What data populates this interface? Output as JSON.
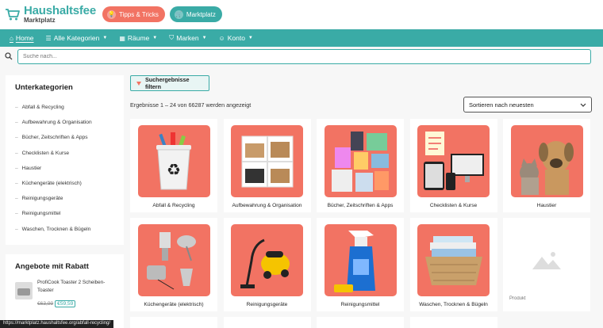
{
  "brand": {
    "name": "Haushaltsfee",
    "sub": "Marktplatz",
    "accent": "#3aaba6",
    "coral": "#f27363"
  },
  "topbar": {
    "tips_label": "Tipps & Tricks",
    "market_label": "Marktplatz"
  },
  "nav": [
    {
      "label": "Home",
      "icon": "home-icon"
    },
    {
      "label": "Alle Kategorien",
      "icon": "list-icon"
    },
    {
      "label": "Räume",
      "icon": "grid-icon"
    },
    {
      "label": "Marken",
      "icon": "shield-icon"
    },
    {
      "label": "Konto",
      "icon": "user-icon"
    }
  ],
  "search": {
    "placeholder": "Suche nach..."
  },
  "sidebar": {
    "subcategories_title": "Unterkategorien",
    "subcategories": [
      "Abfall & Recycling",
      "Aufbewahrung & Organisation",
      "Bücher, Zeitschriften & Apps",
      "Checklisten & Kurse",
      "Haustier",
      "Küchengeräte (elektrisch)",
      "Reinigungsgeräte",
      "Reinigungsmittel",
      "Waschen, Trocknen & Bügeln"
    ],
    "offers_title": "Angebote mit Rabatt",
    "offer": {
      "name": "ProfiCook Toaster 2 Scheiben-Toaster",
      "price_old": "€63,99",
      "price_new": "€59,59"
    }
  },
  "main": {
    "filter_label": "Suchergebnisse filtern",
    "result_count": "Ergebnisse 1 – 24 von 66287 werden angezeigt",
    "sort_label": "Sortieren nach neuesten",
    "cards": [
      {
        "label": "Abfall & Recycling",
        "icon": "recycle-bin-icon"
      },
      {
        "label": "Aufbewahrung & Organisation",
        "icon": "shelf-icon"
      },
      {
        "label": "Bücher, Zeitschriften & Apps",
        "icon": "books-icon"
      },
      {
        "label": "Checklisten & Kurse",
        "icon": "devices-icon"
      },
      {
        "label": "Haustier",
        "icon": "pets-icon"
      },
      {
        "label": "Küchengeräte (elektrisch)",
        "icon": "kitchen-appliances-icon"
      },
      {
        "label": "Reinigungsgeräte",
        "icon": "vacuum-icon"
      },
      {
        "label": "Reinigungsmittel",
        "icon": "spray-bottle-icon"
      },
      {
        "label": "Waschen, Trocknen & Bügeln",
        "icon": "laundry-basket-icon"
      },
      {
        "label": "Produkt",
        "icon": "image-placeholder-icon"
      }
    ]
  },
  "status_url": "https://marktplatz.haushaltsfee.org/abfall-recycling/"
}
